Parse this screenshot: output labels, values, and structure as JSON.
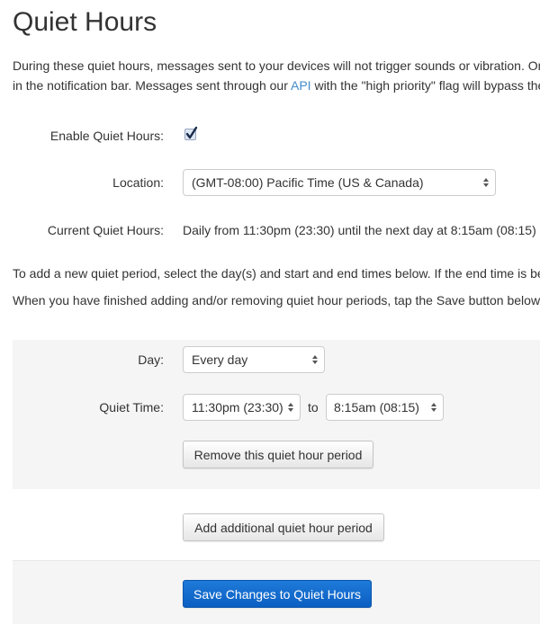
{
  "page": {
    "title": "Quiet Hours",
    "intro": {
      "line1": "During these quiet hours, messages sent to your devices will not trigger sounds or vibration. On",
      "line2_before": "in the notification bar. Messages sent through our ",
      "line2_link": "API",
      "line2_after": " with the \"high priority\" flag will bypass the"
    }
  },
  "settings": {
    "enable_label": "Enable Quiet Hours:",
    "enable_checked": true,
    "location_label": "Location:",
    "location_value": "(GMT-08:00) Pacific Time (US & Canada)",
    "current_label": "Current Quiet Hours:",
    "current_value": "Daily from 11:30pm (23:30) until the next day at 8:15am (08:15)"
  },
  "instructions": {
    "line1": "To add a new quiet period, select the day(s) and start and end times below. If the end time is be",
    "line2": "When you have finished adding and/or removing quiet hour periods, tap the Save button below."
  },
  "period": {
    "day_label": "Day:",
    "day_value": "Every day",
    "time_label": "Quiet Time:",
    "start_value": "11:30pm (23:30)",
    "to_label": "to",
    "end_value": "8:15am (08:15)",
    "remove_label": "Remove this quiet hour period"
  },
  "actions": {
    "add_label": "Add additional quiet hour period",
    "save_label": "Save Changes to Quiet Hours"
  },
  "colors": {
    "link": "#428bca",
    "primary": "#0a5fc2",
    "panel": "#f5f5f5"
  }
}
